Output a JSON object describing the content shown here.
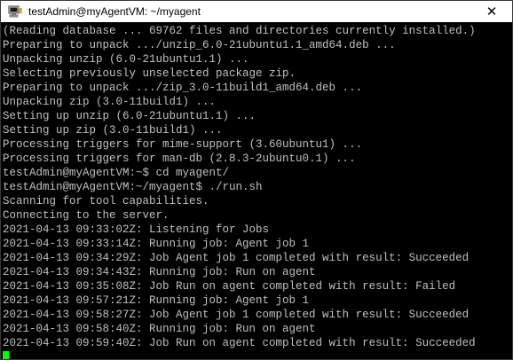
{
  "window": {
    "title": "testAdmin@myAgentVM: ~/myagent",
    "close_glyph": "✕",
    "app_icon": "putty-icon"
  },
  "terminal": {
    "lines": [
      "(Reading database ... 69762 files and directories currently installed.)",
      "Preparing to unpack .../unzip_6.0-21ubuntu1.1_amd64.deb ...",
      "Unpacking unzip (6.0-21ubuntu1.1) ...",
      "Selecting previously unselected package zip.",
      "Preparing to unpack .../zip_3.0-11build1_amd64.deb ...",
      "Unpacking zip (3.0-11build1) ...",
      "Setting up unzip (6.0-21ubuntu1.1) ...",
      "Setting up zip (3.0-11build1) ...",
      "Processing triggers for mime-support (3.60ubuntu1) ...",
      "Processing triggers for man-db (2.8.3-2ubuntu0.1) ...",
      "testAdmin@myAgentVM:~$ cd myagent/",
      "testAdmin@myAgentVM:~/myagent$ ./run.sh",
      "Scanning for tool capabilities.",
      "Connecting to the server.",
      "2021-04-13 09:33:02Z: Listening for Jobs",
      "2021-04-13 09:33:14Z: Running job: Agent job 1",
      "2021-04-13 09:34:29Z: Job Agent job 1 completed with result: Succeeded",
      "2021-04-13 09:34:43Z: Running job: Run on agent",
      "2021-04-13 09:35:08Z: Job Run on agent completed with result: Failed",
      "2021-04-13 09:57:21Z: Running job: Agent job 1",
      "2021-04-13 09:58:27Z: Job Agent job 1 completed with result: Succeeded",
      "2021-04-13 09:58:40Z: Running job: Run on agent",
      "2021-04-13 09:59:40Z: Job Run on agent completed with result: Succeeded"
    ],
    "text_color": "#c0c0c0",
    "background_color": "#000000",
    "cursor_color": "#00ff00"
  }
}
